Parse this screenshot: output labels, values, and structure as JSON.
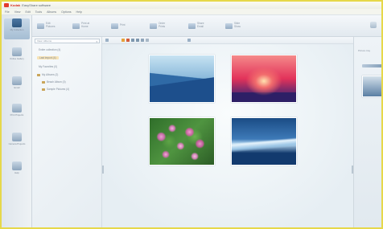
{
  "window": {
    "brand": "Kodak",
    "title": "EasyShare software",
    "border_color": "#e6d84a"
  },
  "menu": [
    "File",
    "View",
    "Edit",
    "Tools",
    "Albums",
    "Options",
    "Help"
  ],
  "toolbar": {
    "buttons": [
      {
        "icon": "edit-picture-icon",
        "label": "Edit Pictures"
      },
      {
        "icon": "print-at-home-icon",
        "label": "Print at Home"
      },
      {
        "icon": "print-icon",
        "label": "Print"
      },
      {
        "icon": "order-prints-icon",
        "label": "Order Prints"
      },
      {
        "icon": "share-email-icon",
        "label": "Share Email"
      },
      {
        "icon": "slide-show-icon",
        "label": "Slide Show"
      }
    ]
  },
  "nav": [
    {
      "icon": "my-collection-icon",
      "label": "My Collection",
      "active": true
    },
    {
      "icon": "online-gallery-icon",
      "label": "Online Gallery",
      "active": false
    },
    {
      "icon": "email-icon",
      "label": "Email",
      "active": false
    },
    {
      "icon": "print-projects-icon",
      "label": "Print Projects",
      "active": false
    },
    {
      "icon": "camera-icon",
      "label": "Camera Projects",
      "active": false
    },
    {
      "icon": "help-icon",
      "label": "Help",
      "active": false
    }
  ],
  "folders": {
    "view_dropdown": "View: Albums",
    "items": [
      {
        "label": "Entire collection (4)",
        "indent": 0,
        "selected": false
      },
      {
        "label": "Last import (4)",
        "indent": 0,
        "selected": true
      },
      {
        "label": "My Favorites (0)",
        "indent": 0,
        "selected": false
      },
      {
        "label": "My Albums (2)",
        "indent": 0,
        "selected": false
      },
      {
        "label": "Beach Album (0)",
        "indent": 1,
        "selected": false
      },
      {
        "label": "Sample Pictures (4)",
        "indent": 1,
        "selected": false
      }
    ]
  },
  "photos": [
    {
      "name": "photo-blue-mountains",
      "palette": [
        "#c7e3f2",
        "#4b8dc2",
        "#1d4f8c"
      ]
    },
    {
      "name": "photo-sunset",
      "palette": [
        "#f58a8a",
        "#e2325a",
        "#2d1f66"
      ]
    },
    {
      "name": "photo-water-lilies",
      "palette": [
        "#2f6e2a",
        "#5ea446",
        "#d98ac2"
      ]
    },
    {
      "name": "photo-winter-frost",
      "palette": [
        "#d9ecf9",
        "#3e7ab8",
        "#123a6e"
      ]
    }
  ],
  "right_panel": {
    "title": "Picture tray"
  }
}
